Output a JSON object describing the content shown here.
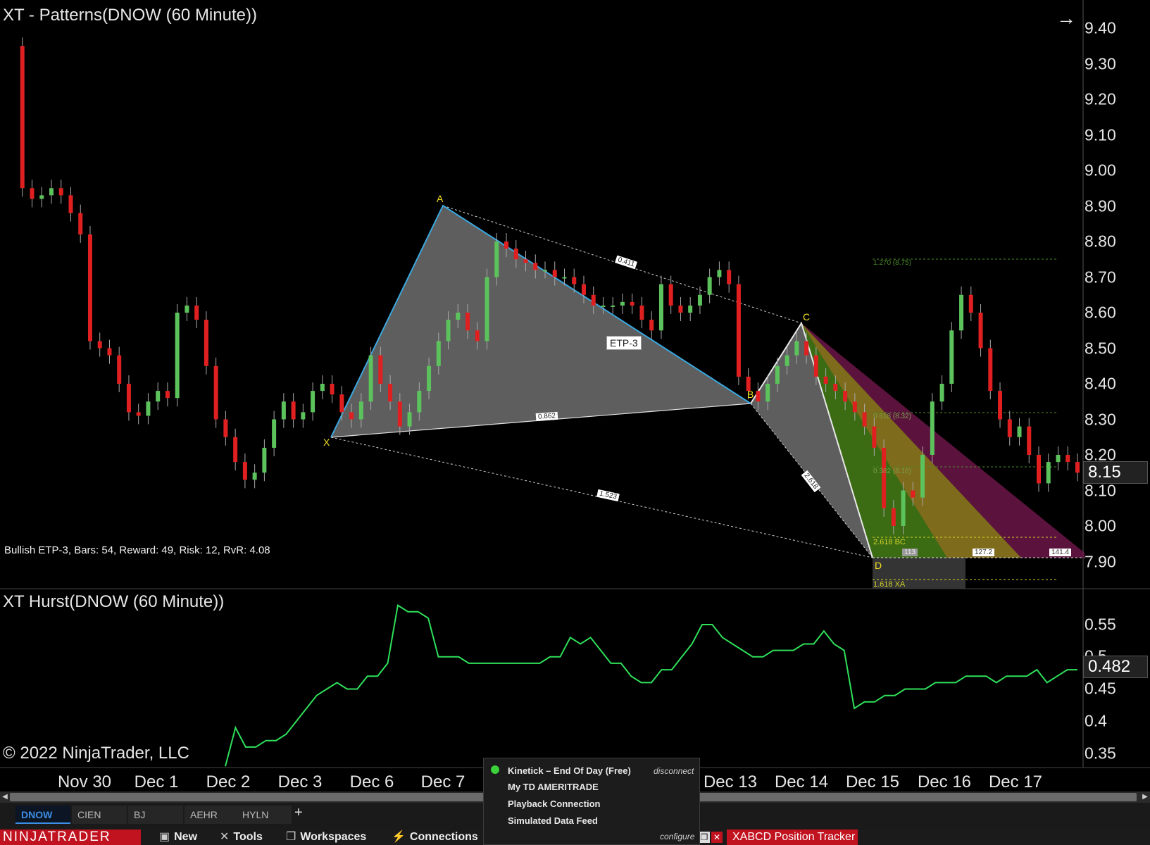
{
  "chart": {
    "title": "XT - Patterns(DNOW (60 Minute))",
    "price_axis": [
      "9.40",
      "9.30",
      "9.20",
      "9.10",
      "9.00",
      "8.90",
      "8.80",
      "8.70",
      "8.60",
      "8.50",
      "8.40",
      "8.30",
      "8.20",
      "8.10",
      "8.00",
      "7.90"
    ],
    "last_price": "8.15",
    "pattern_label": "ETP-3",
    "pattern_points": {
      "x": "X",
      "a": "A",
      "b": "B",
      "c": "C",
      "d": "D"
    },
    "ratio_labels": {
      "xa_ac": "0.411",
      "xb": "0.862",
      "xd": "1.523",
      "bd": "2.618"
    },
    "level_labels": {
      "l1270": "1.270 (8.75)",
      "l618": "0.618 (8.32)",
      "l382": "0.382 (8.16)",
      "bc": "2.618 BC",
      "xa": "1.618 XA"
    },
    "box_labels": {
      "b113": "113",
      "b127": "127.2",
      "b141": "141.4"
    },
    "status_text": "Bullish ETP-3, Bars: 54, Reward: 49, Risk: 12, RvR: 4.08",
    "colors": {
      "bull": "#5cc25c",
      "bear": "#e02020",
      "pattern_fill": "#7a7a7a",
      "pattern_edge": "#3aa8e0",
      "hurst": "#2fe05a"
    }
  },
  "hurst": {
    "title": "XT Hurst(DNOW (60 Minute))",
    "axis": [
      "0.55",
      "0.5",
      "0.45",
      "0.4",
      "0.35"
    ],
    "last_value": "0.482",
    "values": [
      0.33,
      0.39,
      0.36,
      0.36,
      0.37,
      0.37,
      0.38,
      0.4,
      0.42,
      0.44,
      0.45,
      0.46,
      0.45,
      0.45,
      0.47,
      0.47,
      0.49,
      0.58,
      0.57,
      0.57,
      0.56,
      0.5,
      0.5,
      0.5,
      0.49,
      0.49,
      0.49,
      0.49,
      0.49,
      0.49,
      0.49,
      0.49,
      0.5,
      0.5,
      0.53,
      0.52,
      0.53,
      0.51,
      0.49,
      0.49,
      0.47,
      0.46,
      0.46,
      0.48,
      0.48,
      0.5,
      0.52,
      0.55,
      0.55,
      0.53,
      0.52,
      0.51,
      0.5,
      0.5,
      0.51,
      0.51,
      0.51,
      0.52,
      0.52,
      0.54,
      0.52,
      0.51,
      0.42,
      0.43,
      0.43,
      0.44,
      0.44,
      0.45,
      0.45,
      0.45,
      0.46,
      0.46,
      0.46,
      0.47,
      0.47,
      0.47,
      0.46,
      0.47,
      0.47,
      0.47,
      0.48,
      0.46,
      0.47,
      0.48,
      0.48
    ]
  },
  "x_axis": {
    "dates": [
      "Nov 30",
      "Dec 1",
      "Dec 2",
      "Dec 3",
      "Dec 6",
      "Dec 7",
      "Dec 13",
      "Dec 14",
      "Dec 15",
      "Dec 16",
      "Dec 17"
    ]
  },
  "copyright": "© 2022 NinjaTrader, LLC",
  "tabs": [
    "DNOW",
    "CIEN",
    "BJ",
    "AEHR",
    "HYLN"
  ],
  "control_bar": {
    "brand": "NINJATRADER",
    "new": "New",
    "tools": "Tools",
    "workspaces": "Workspaces",
    "connections": "Connections",
    "xabcd_tracker": "XABCD Position Tracker"
  },
  "connections_popup": {
    "items": [
      "Kinetick – End Of Day (Free)",
      "My TD AMERITRADE",
      "Playback Connection",
      "Simulated Data Feed"
    ],
    "disconnect": "disconnect",
    "configure": "configure"
  }
}
